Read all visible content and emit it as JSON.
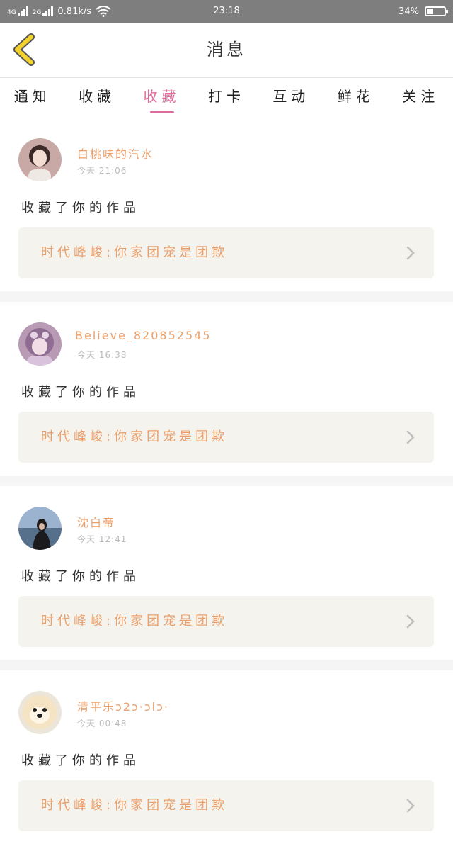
{
  "status_bar": {
    "net_4g": "4G",
    "net_2g": "2G",
    "speed": "0.81k/s",
    "time": "23:18",
    "battery": "34%",
    "battery_level": 0.34
  },
  "header": {
    "title": "消息",
    "back_icon": "chevron-left-icon"
  },
  "tabs": [
    {
      "label": "通知",
      "active": false
    },
    {
      "label": "收藏",
      "active": false
    },
    {
      "label": "收藏",
      "active": true
    },
    {
      "label": "打卡",
      "active": false
    },
    {
      "label": "互动",
      "active": false
    },
    {
      "label": "鲜花",
      "active": false
    },
    {
      "label": "关注",
      "active": false
    }
  ],
  "messages": [
    {
      "user": "白桃味的汽水",
      "time": "今天 21:06",
      "action": "收藏了你的作品",
      "work_title": "时代峰峻:你家团宠是团欺"
    },
    {
      "user": "Believe_820852545",
      "time": "今天 16:38",
      "action": "收藏了你的作品",
      "work_title": "时代峰峻:你家团宠是团欺"
    },
    {
      "user": "沈白帝",
      "time": "今天 12:41",
      "action": "收藏了你的作品",
      "work_title": "时代峰峻:你家团宠是团欺"
    },
    {
      "user": "清平乐ↄ2ↄ·ↄlↄ·",
      "time": "今天 00:48",
      "action": "收藏了你的作品",
      "work_title": "时代峰峻:你家团宠是团欺"
    }
  ],
  "colors": {
    "accent": "#e06a9b",
    "username": "#eba06b",
    "card_bg": "#f4f3ee",
    "status_bar": "#7e7e7e",
    "back_icon": "#f4d22e"
  }
}
